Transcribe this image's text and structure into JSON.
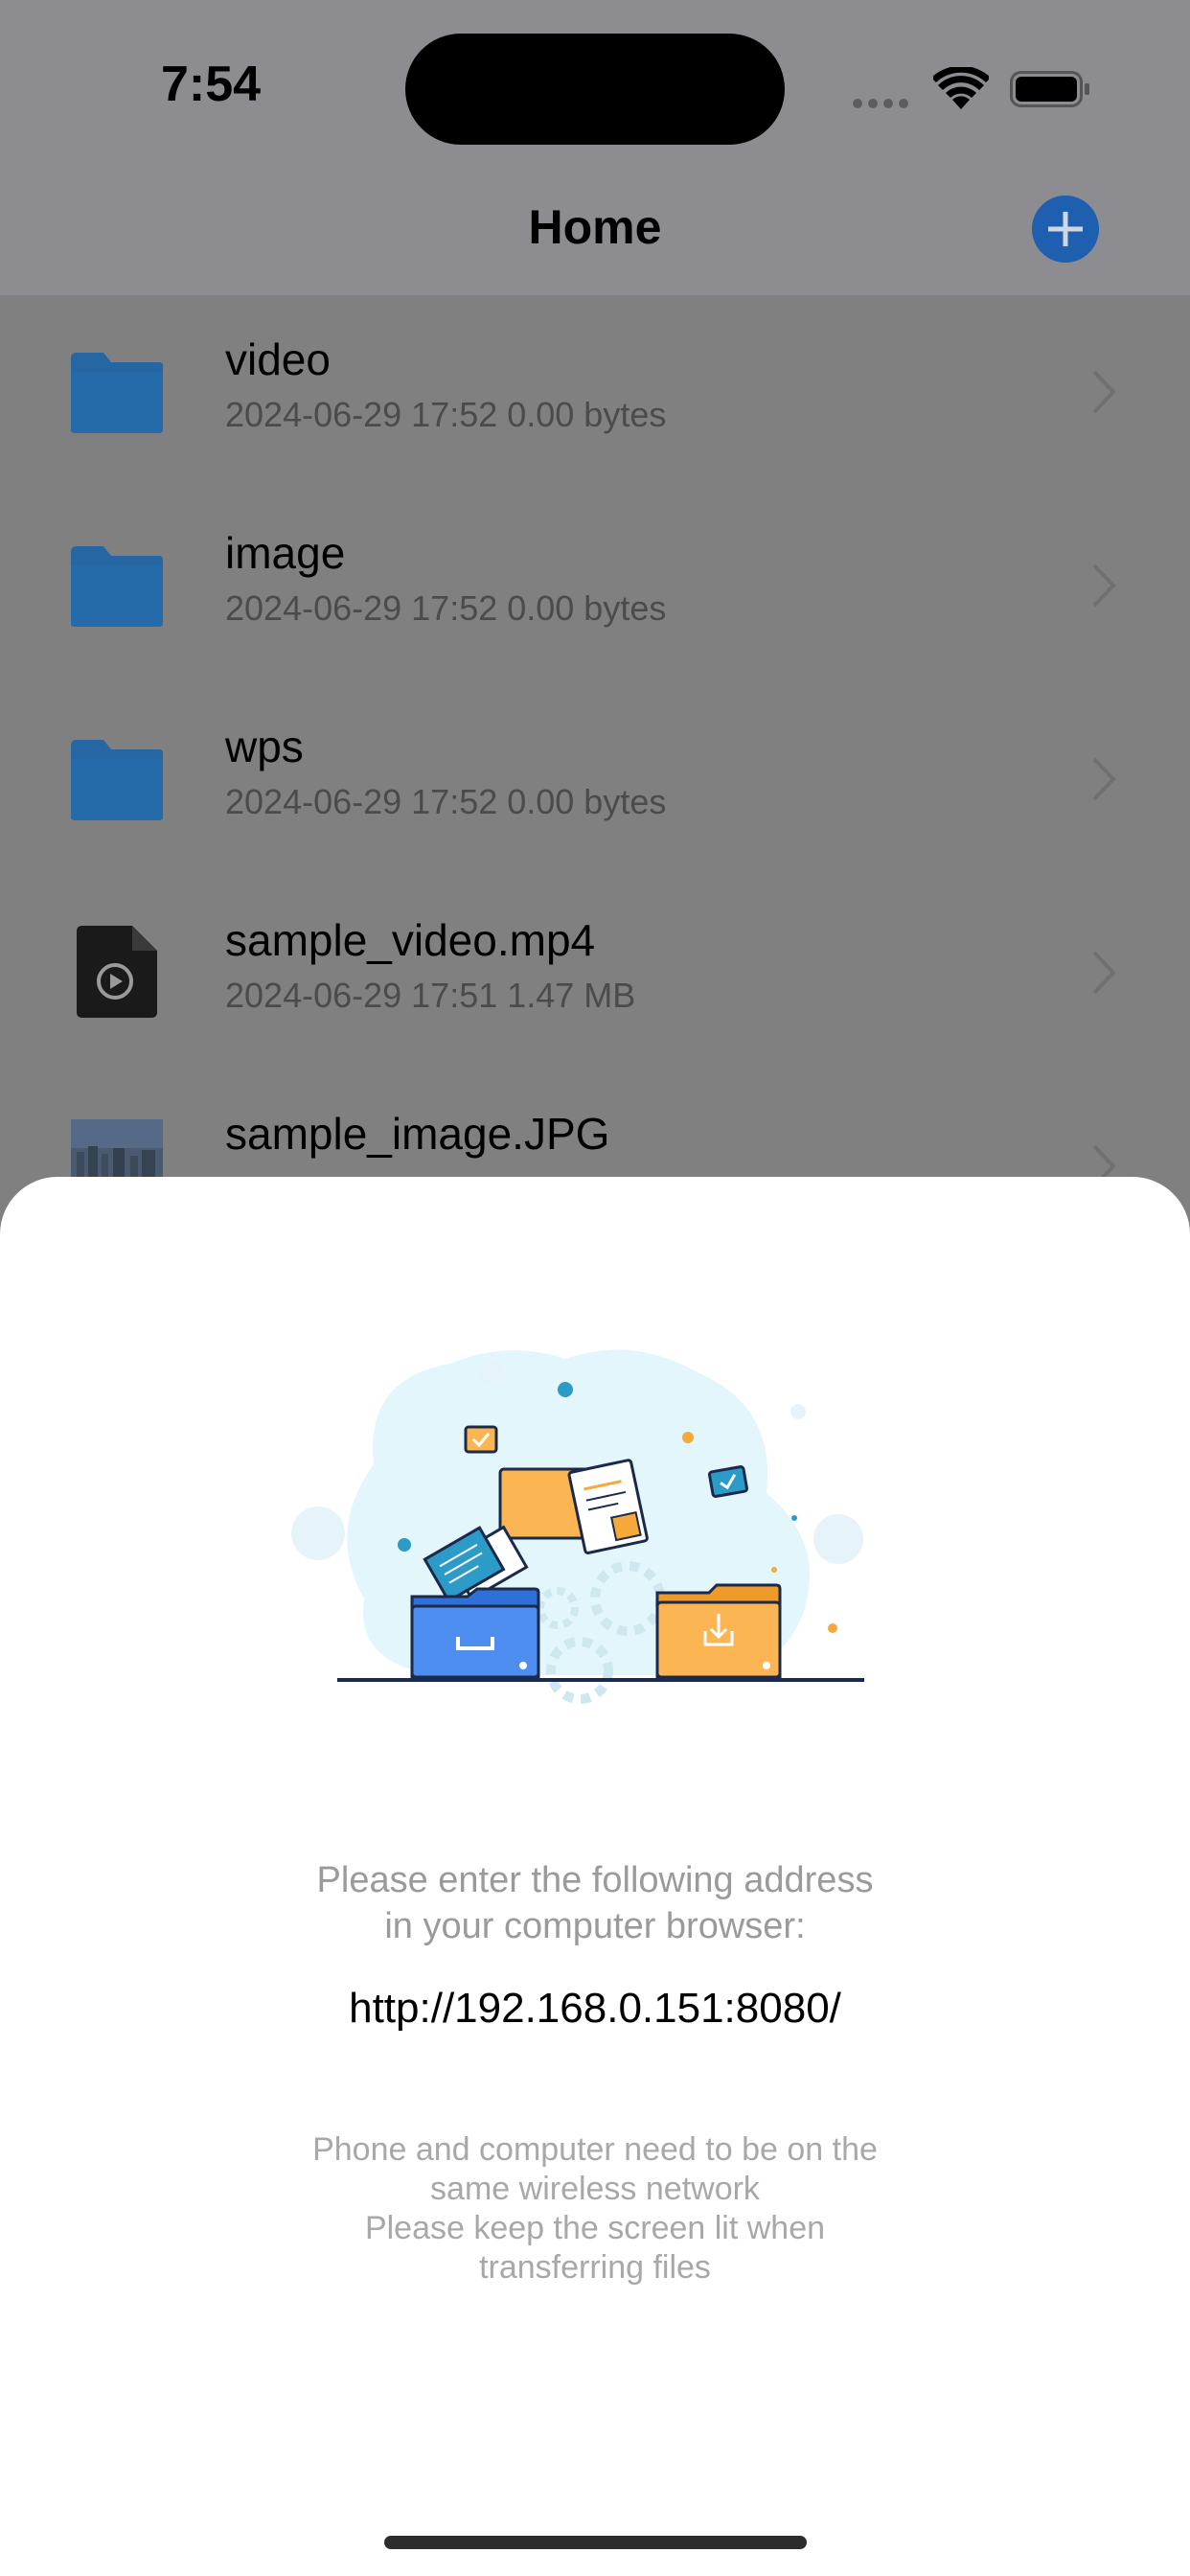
{
  "status_bar": {
    "time": "7:54"
  },
  "nav": {
    "title": "Home",
    "add_icon": "plus-circle-icon",
    "accent_color": "#1f5fb0"
  },
  "files": [
    {
      "name": "video",
      "meta": "2024-06-29 17:52  0.00 bytes",
      "icon": "folder-icon"
    },
    {
      "name": "image",
      "meta": "2024-06-29 17:52  0.00 bytes",
      "icon": "folder-icon"
    },
    {
      "name": "wps",
      "meta": "2024-06-29 17:52  0.00 bytes",
      "icon": "folder-icon"
    },
    {
      "name": "sample_video.mp4",
      "meta": "2024-06-29 17:51  1.47 MB",
      "icon": "video-file-icon"
    },
    {
      "name": "sample_image.JPG",
      "icon": "image-thumbnail"
    }
  ],
  "sheet": {
    "instruction_line1": "Please enter the following address",
    "instruction_line2": "in your computer browser:",
    "url": "http://192.168.0.151:8080/",
    "note_line1": "Phone and computer need to be on the",
    "note_line2": "same wireless network",
    "note_line3": "Please keep the screen lit when",
    "note_line4": "transferring files"
  }
}
